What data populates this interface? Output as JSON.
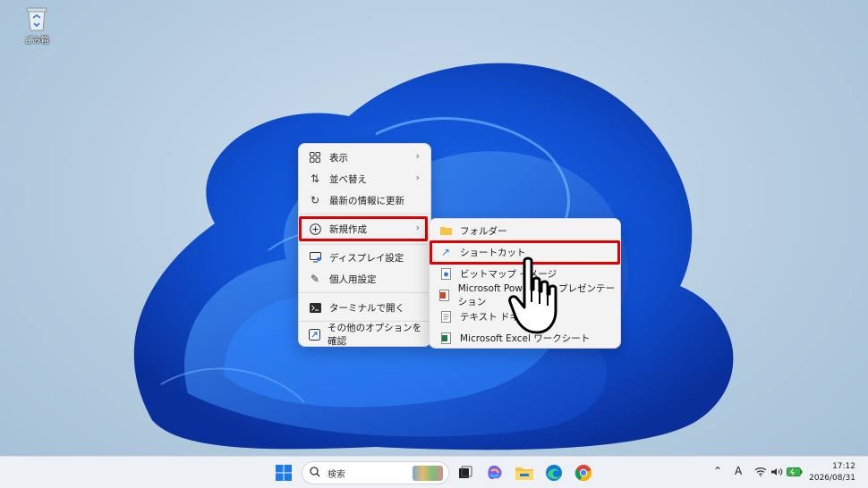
{
  "desktop": {
    "recycle_bin_label": "ごみ箱",
    "recycle_bin_icon": "recycle-bin-icon"
  },
  "context_menu": {
    "items": [
      {
        "label": "表示",
        "icon": "grid-icon",
        "has_submenu": true
      },
      {
        "label": "並べ替え",
        "icon": "sort-icon",
        "has_submenu": true
      },
      {
        "label": "最新の情報に更新",
        "icon": "refresh-icon",
        "has_submenu": false
      },
      {
        "label": "新規作成",
        "icon": "add-icon",
        "has_submenu": true,
        "highlighted": true
      },
      {
        "label": "ディスプレイ設定",
        "icon": "display-settings-icon",
        "has_submenu": false
      },
      {
        "label": "個人用設定",
        "icon": "brush-icon",
        "has_submenu": false
      },
      {
        "label": "ターミナルで開く",
        "icon": "terminal-icon",
        "has_submenu": false
      },
      {
        "label": "その他のオプションを確認",
        "icon": "more-options-icon",
        "has_submenu": false
      }
    ]
  },
  "submenu": {
    "items": [
      {
        "label": "フォルダー",
        "icon": "folder-icon"
      },
      {
        "label": "ショートカット",
        "icon": "shortcut-arrow-icon",
        "highlighted": true
      },
      {
        "label": "ビットマップ イメージ",
        "icon": "bitmap-icon"
      },
      {
        "label": "Microsoft PowerPoint プレゼンテーション",
        "icon": "powerpoint-icon"
      },
      {
        "label": "テキスト ドキュメント",
        "icon": "text-document-icon"
      },
      {
        "label": "Microsoft Excel ワークシート",
        "icon": "excel-icon"
      }
    ]
  },
  "taskbar": {
    "search_placeholder": "検索",
    "tray_ime": "A",
    "clock_time": "17:12",
    "clock_date": "2026/08/31"
  },
  "colors": {
    "highlight_box": "#e00000",
    "taskbar_bg": "#edf1f6"
  }
}
